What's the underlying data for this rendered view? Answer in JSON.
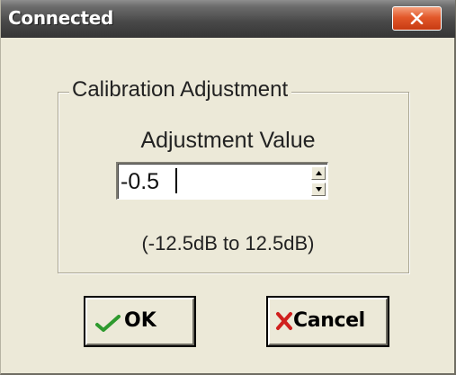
{
  "window": {
    "title": "Connected",
    "close_icon": "close-x-icon"
  },
  "calibration": {
    "group_title": "Calibration Adjustment",
    "value_label": "Adjustment Value",
    "value": "-0.5",
    "range_text": "(-12.5dB to 12.5dB)"
  },
  "buttons": {
    "ok_label": "OK",
    "ok_icon": "checkmark-icon",
    "cancel_label": "Cancel",
    "cancel_icon": "x-icon"
  },
  "colors": {
    "titlebar": "#474747",
    "close_button": "#e3582a",
    "dialog_background": "#ece9d8",
    "ok_check": "#2e9a2e",
    "cancel_x": "#d0201e"
  }
}
